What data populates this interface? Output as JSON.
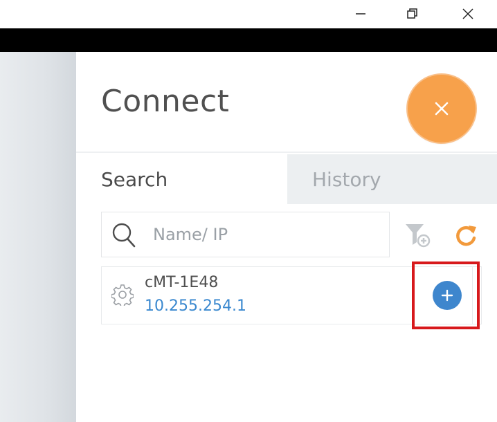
{
  "window_controls": {
    "minimize": "minimize-icon",
    "restore": "restore-icon",
    "close": "close-icon"
  },
  "panel": {
    "title": "Connect",
    "close_icon": "close-icon"
  },
  "tabs": [
    {
      "label": "Search",
      "active": true
    },
    {
      "label": "History",
      "active": false
    }
  ],
  "search": {
    "placeholder": "Name/ IP",
    "value": "",
    "icon": "search-icon"
  },
  "toolbar": {
    "filter_icon": "filter-add-icon",
    "refresh_icon": "refresh-icon"
  },
  "devices": [
    {
      "name": "cMT-1E48",
      "ip": "10.255.254.1",
      "icon": "gear-icon",
      "action_icon": "plus-icon"
    }
  ],
  "colors": {
    "accent_orange": "#f7a14b",
    "link_blue": "#3a88cf",
    "add_button_blue": "#3e86cd",
    "highlight_red": "#d7191c",
    "inactive_tab_bg": "#eceff1"
  }
}
